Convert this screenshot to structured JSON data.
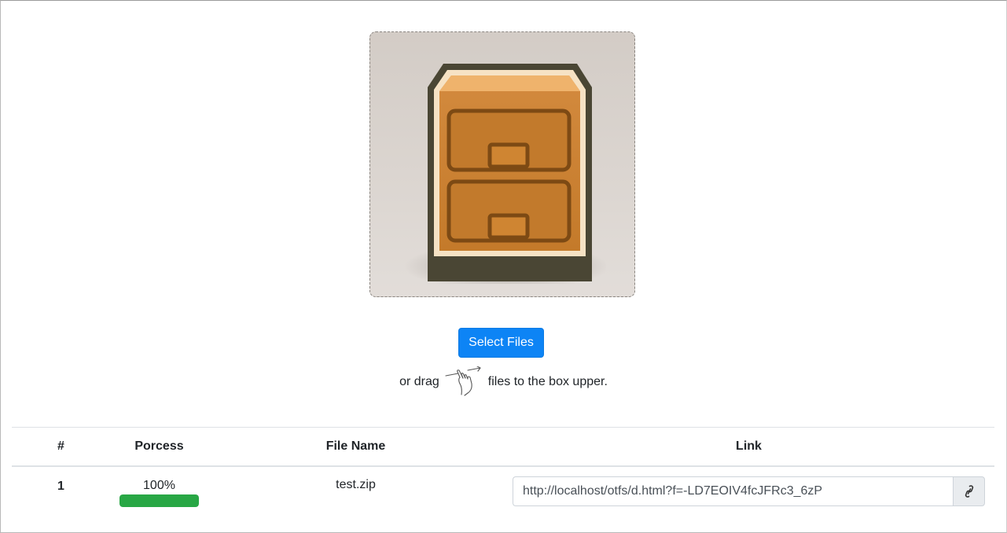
{
  "dropzone": {
    "icon": "file-cabinet-icon"
  },
  "actions": {
    "select_files_label": "Select Files"
  },
  "drag_hint": {
    "prefix": "or drag",
    "icon": "drag-hand-icon",
    "suffix": "files to the box upper."
  },
  "table": {
    "headers": {
      "num": "#",
      "process": "Porcess",
      "file_name": "File Name",
      "link": "Link"
    },
    "rows": [
      {
        "num": "1",
        "progress_text": "100%",
        "progress_fraction": 1.0,
        "file_name": "test.zip",
        "link": "http://localhost/otfs/d.html?f=-LD7EOIV4fcJFRc3_6zP",
        "copy_icon": "link-icon"
      }
    ]
  },
  "colors": {
    "primary": "#0d84f5",
    "success": "#28a745"
  }
}
